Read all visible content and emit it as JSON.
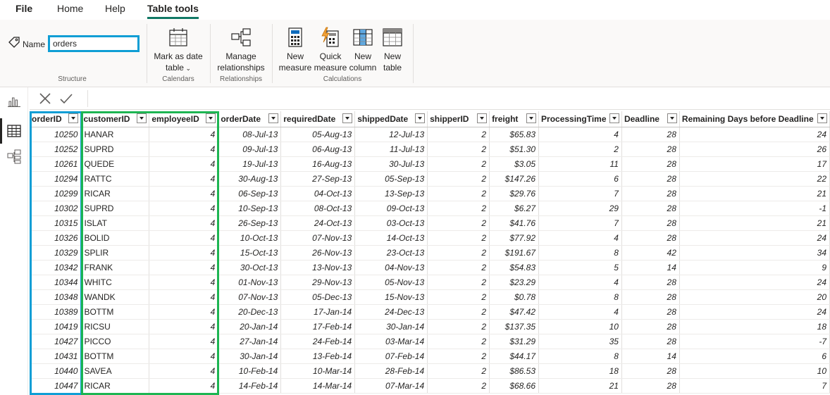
{
  "menu": {
    "tabs": [
      "File",
      "Home",
      "Help",
      "Table tools"
    ],
    "active": "Table tools"
  },
  "ribbon": {
    "name_label": "Name",
    "name_value": "orders",
    "groups": {
      "structure": "Structure",
      "calendars": "Calendars",
      "relationships": "Relationships",
      "calculations": "Calculations"
    },
    "buttons": {
      "mark_as_date_table_line1": "Mark as date",
      "mark_as_date_table_line2": "table",
      "manage_relationships_line1": "Manage",
      "manage_relationships_line2": "relationships",
      "new_measure_line1": "New",
      "new_measure_line2": "measure",
      "quick_measure_line1": "Quick",
      "quick_measure_line2": "measure",
      "new_column_line1": "New",
      "new_column_line2": "column",
      "new_table_line1": "New",
      "new_table_line2": "table"
    }
  },
  "colors": {
    "accent": "#117865",
    "highlight_blue": "#0f9ed5",
    "highlight_green": "#1db552"
  },
  "table": {
    "columns": [
      "orderID",
      "customerID",
      "employeeID",
      "orderDate",
      "requiredDate",
      "shippedDate",
      "shipperID",
      "freight",
      "ProcessingTime",
      "Deadline",
      "Remaining Days before Deadline"
    ],
    "rows": [
      [
        "10250",
        "HANAR",
        "4",
        "08-Jul-13",
        "05-Aug-13",
        "12-Jul-13",
        "2",
        "$65.83",
        "4",
        "28",
        "24"
      ],
      [
        "10252",
        "SUPRD",
        "4",
        "09-Jul-13",
        "06-Aug-13",
        "11-Jul-13",
        "2",
        "$51.30",
        "2",
        "28",
        "26"
      ],
      [
        "10261",
        "QUEDE",
        "4",
        "19-Jul-13",
        "16-Aug-13",
        "30-Jul-13",
        "2",
        "$3.05",
        "11",
        "28",
        "17"
      ],
      [
        "10294",
        "RATTC",
        "4",
        "30-Aug-13",
        "27-Sep-13",
        "05-Sep-13",
        "2",
        "$147.26",
        "6",
        "28",
        "22"
      ],
      [
        "10299",
        "RICAR",
        "4",
        "06-Sep-13",
        "04-Oct-13",
        "13-Sep-13",
        "2",
        "$29.76",
        "7",
        "28",
        "21"
      ],
      [
        "10302",
        "SUPRD",
        "4",
        "10-Sep-13",
        "08-Oct-13",
        "09-Oct-13",
        "2",
        "$6.27",
        "29",
        "28",
        "-1"
      ],
      [
        "10315",
        "ISLAT",
        "4",
        "26-Sep-13",
        "24-Oct-13",
        "03-Oct-13",
        "2",
        "$41.76",
        "7",
        "28",
        "21"
      ],
      [
        "10326",
        "BOLID",
        "4",
        "10-Oct-13",
        "07-Nov-13",
        "14-Oct-13",
        "2",
        "$77.92",
        "4",
        "28",
        "24"
      ],
      [
        "10329",
        "SPLIR",
        "4",
        "15-Oct-13",
        "26-Nov-13",
        "23-Oct-13",
        "2",
        "$191.67",
        "8",
        "42",
        "34"
      ],
      [
        "10342",
        "FRANK",
        "4",
        "30-Oct-13",
        "13-Nov-13",
        "04-Nov-13",
        "2",
        "$54.83",
        "5",
        "14",
        "9"
      ],
      [
        "10344",
        "WHITC",
        "4",
        "01-Nov-13",
        "29-Nov-13",
        "05-Nov-13",
        "2",
        "$23.29",
        "4",
        "28",
        "24"
      ],
      [
        "10348",
        "WANDK",
        "4",
        "07-Nov-13",
        "05-Dec-13",
        "15-Nov-13",
        "2",
        "$0.78",
        "8",
        "28",
        "20"
      ],
      [
        "10389",
        "BOTTM",
        "4",
        "20-Dec-13",
        "17-Jan-14",
        "24-Dec-13",
        "2",
        "$47.42",
        "4",
        "28",
        "24"
      ],
      [
        "10419",
        "RICSU",
        "4",
        "20-Jan-14",
        "17-Feb-14",
        "30-Jan-14",
        "2",
        "$137.35",
        "10",
        "28",
        "18"
      ],
      [
        "10427",
        "PICCO",
        "4",
        "27-Jan-14",
        "24-Feb-14",
        "03-Mar-14",
        "2",
        "$31.29",
        "35",
        "28",
        "-7"
      ],
      [
        "10431",
        "BOTTM",
        "4",
        "30-Jan-14",
        "13-Feb-14",
        "07-Feb-14",
        "2",
        "$44.17",
        "8",
        "14",
        "6"
      ],
      [
        "10440",
        "SAVEA",
        "4",
        "10-Feb-14",
        "10-Mar-14",
        "28-Feb-14",
        "2",
        "$86.53",
        "18",
        "28",
        "10"
      ],
      [
        "10447",
        "RICAR",
        "4",
        "14-Feb-14",
        "14-Mar-14",
        "07-Mar-14",
        "2",
        "$68.66",
        "21",
        "28",
        "7"
      ]
    ]
  }
}
